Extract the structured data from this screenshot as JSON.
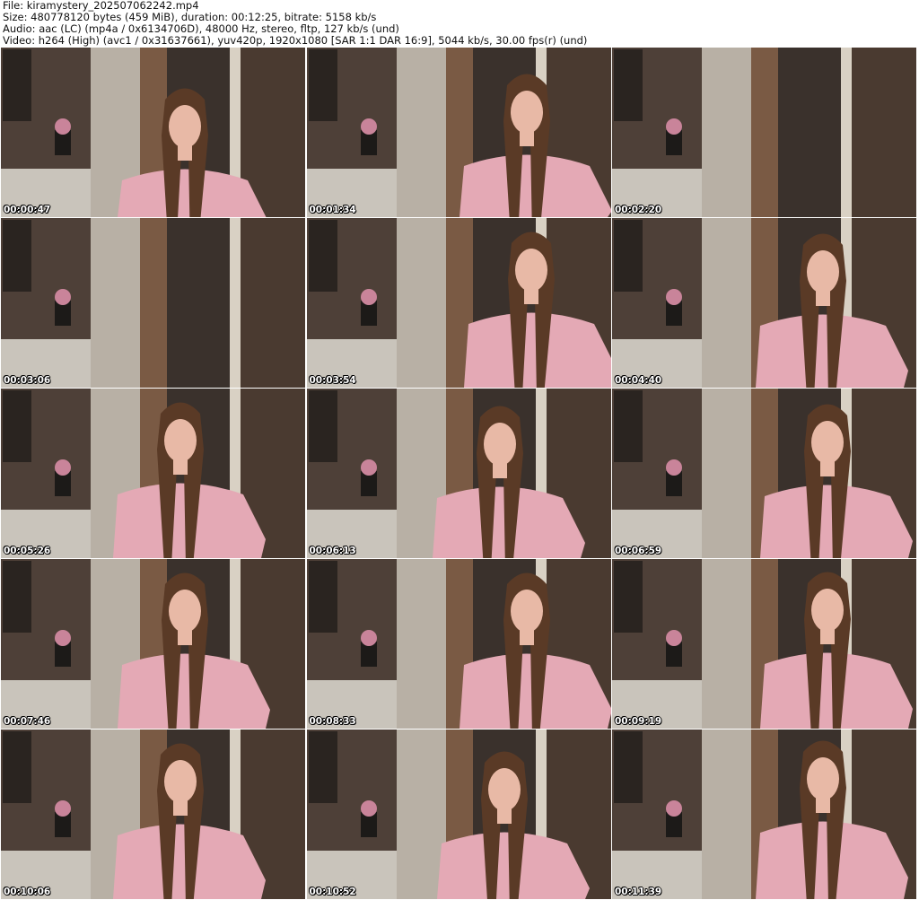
{
  "header": {
    "file_line": "File: kiramystery_202507062242.mp4",
    "size_line": "Size: 480778120 bytes (459 MiB), duration: 00:12:25, bitrate: 5158 kb/s",
    "audio_line": "Audio: aac (LC) (mp4a / 0x6134706D), 48000 Hz, stereo, fltp, 127 kb/s (und)",
    "video_line": "Video: h264 (High) (avc1 / 0x31637661), yuv420p, 1920x1080 [SAR 1:1 DAR 16:9], 5044 kb/s, 30.00 fps(r) (und)"
  },
  "thumbnails": [
    {
      "timestamp": "00:00:47"
    },
    {
      "timestamp": "00:01:34"
    },
    {
      "timestamp": "00:02:20"
    },
    {
      "timestamp": "00:03:06"
    },
    {
      "timestamp": "00:03:54"
    },
    {
      "timestamp": "00:04:40"
    },
    {
      "timestamp": "00:05:26"
    },
    {
      "timestamp": "00:06:13"
    },
    {
      "timestamp": "00:06:59"
    },
    {
      "timestamp": "00:07:46"
    },
    {
      "timestamp": "00:08:33"
    },
    {
      "timestamp": "00:09:19"
    },
    {
      "timestamp": "00:10:06"
    },
    {
      "timestamp": "00:10:52"
    },
    {
      "timestamp": "00:11:39"
    }
  ],
  "colors": {
    "wall": "#5e4e44",
    "cabinet": "#c9c4bb",
    "shirt": "#e4a9b5",
    "hair": "#5a3a26",
    "skin": "#e8b9a6",
    "curtain": "#3a312c"
  }
}
